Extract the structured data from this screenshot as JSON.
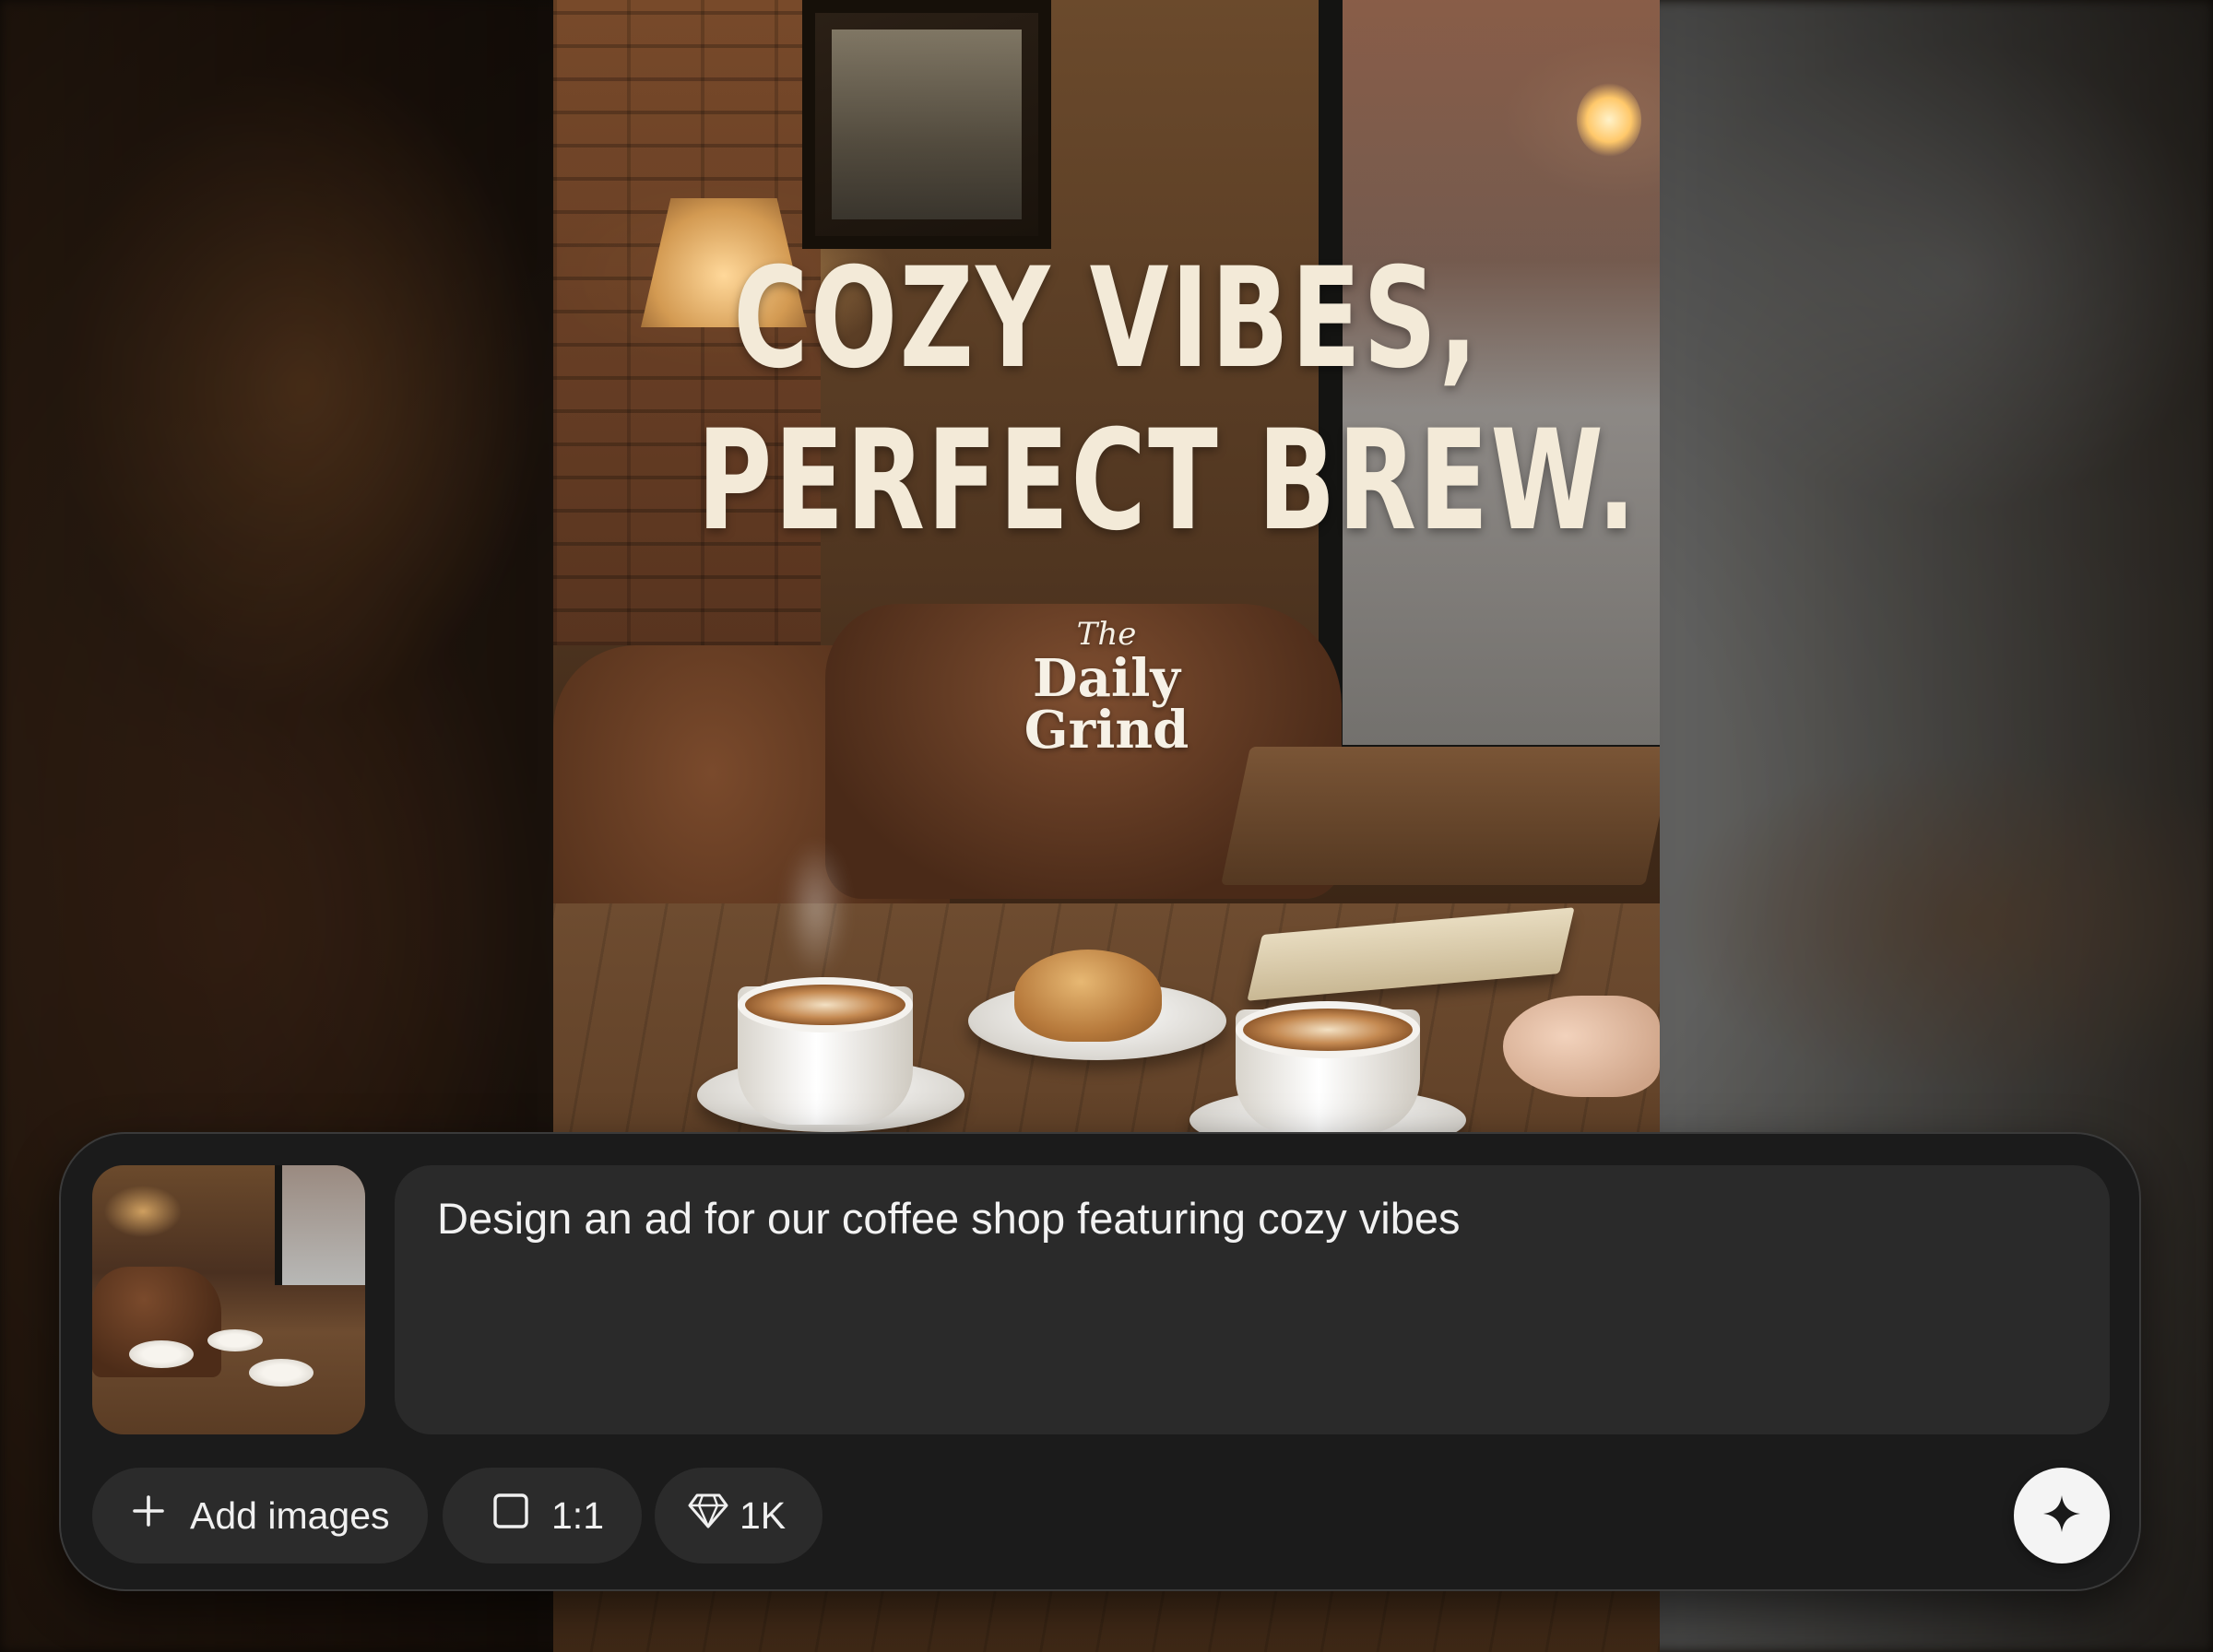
{
  "poster": {
    "headline_line1": "COZY VIBES,",
    "headline_line2": "PERFECT BREW.",
    "logo_the": "The",
    "logo_line1": "Daily",
    "logo_line2": "Grind"
  },
  "composer": {
    "prompt_text": "Design an ad for our coffee shop featuring cozy vibes",
    "add_images_label": "Add images",
    "aspect_ratio_label": "1:1",
    "resolution_label": "1K",
    "icons": {
      "add": "plus-icon",
      "aspect_ratio": "square-icon",
      "resolution": "diamond-icon",
      "generate": "sparkle-icon"
    }
  },
  "colors": {
    "panel_bg": "#1b1b1b",
    "prompt_bg": "#2a2a2a",
    "chip_bg": "#2b2b2b",
    "send_button_bg": "#f4f4f4",
    "headline_text": "#f3ead8"
  }
}
